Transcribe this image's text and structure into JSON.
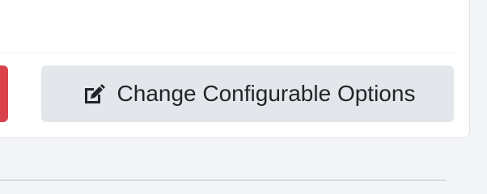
{
  "actions": {
    "change_options_label": "Change Configurable Options",
    "change_options_icon": "edit-icon"
  },
  "colors": {
    "danger": "#d9424b",
    "secondary": "#e3e6ea",
    "text": "#212529"
  }
}
